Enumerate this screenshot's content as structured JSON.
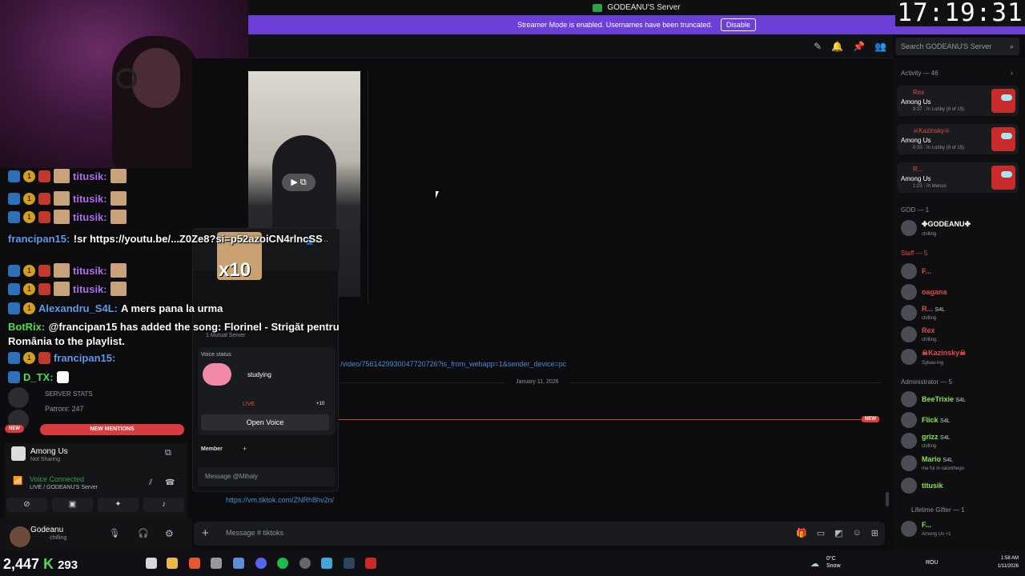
{
  "titlebar": {
    "title": "GODEANU'S Server"
  },
  "streamer": {
    "text": "Streamer Mode is enabled. Usernames have been truncated.",
    "disable": "Disable"
  },
  "clock": "17:19:31",
  "search": {
    "placeholder": "Search GODEANU'S Server"
  },
  "chat_overlay": [
    {
      "user": "titusik:",
      "color": "purple"
    },
    {
      "user": "titusik:",
      "color": "purple"
    },
    {
      "user": "titusik:",
      "color": "purple"
    },
    {
      "user": "francipan15:",
      "text": "!sr https://youtu.be/...Z0Ze8?si=p52azoiCN4rlncSS",
      "color": "blue"
    },
    {
      "user": "titusik:",
      "color": "purple"
    },
    {
      "user": "titusik:",
      "color": "purple"
    },
    {
      "user": "Alexandru_S4L:",
      "text": "A mers pana la urma",
      "color": "blue"
    },
    {
      "user": "BotRix:",
      "text": "@francipan15 has added the song: Florinel - Strigăt pentru România to the playlist.",
      "color": "green"
    },
    {
      "user": "francipan15:",
      "color": "blue"
    },
    {
      "user": "D_TX:",
      "color": "green"
    }
  ],
  "chat": {
    "link1": "/video/7561429930047720726?is_from_webapp=1&sender_device=pc",
    "date": "January 11, 2026",
    "new": "NEW",
    "last_link": "https://vm.tiktok.com/ZNRh8hv2n/",
    "composer_placeholder": "Message # tiktoks"
  },
  "left": {
    "server_stats": "SERVER STATS",
    "patroni": "Patroni: 247",
    "new": "NEW",
    "new_mentions": "NEW MENTIONS",
    "game": "Among Us",
    "game_sub": "Not Sharing",
    "voice_connected": "Voice Connected",
    "voice_sub": "LIVE / GODEANU'S Server",
    "username": "Godeanu",
    "user_status": "chilling"
  },
  "popout": {
    "x10": "x10",
    "mutual": "1 Mutual Server",
    "voice_status": "Voice status",
    "studying": "studying",
    "live": "LIVE",
    "count": "+10",
    "open_voice": "Open Voice",
    "member": "Member",
    "message_placeholder": "Message @Mihaly"
  },
  "right": {
    "activity": "Activity — 46",
    "cards": [
      {
        "name": "Rex",
        "game": "Among Us",
        "status": "9:37 · In Lobby (8 of 15)"
      },
      {
        "name": "☠Kazinsky☠",
        "game": "Among Us",
        "status": "0:33 · In Lobby (8 of 15)"
      },
      {
        "name": "R...",
        "game": "Among Us",
        "status": "1:23 · In Menus"
      }
    ],
    "god_header": "GOD — 1",
    "god": {
      "name": "✤GODEANU✤",
      "sub": "chilling"
    },
    "staff_header": "Staff — 5",
    "staff": [
      {
        "name": "F...",
        "sub": "",
        "color": "#e04b4b"
      },
      {
        "name": "oagana",
        "sub": "",
        "color": "#e04b4b"
      },
      {
        "name": "R...",
        "sub": "chilling",
        "color": "#e04b4b",
        "tag": "S4L"
      },
      {
        "name": "Rex",
        "sub": "chilling",
        "color": "#e04b4b"
      },
      {
        "name": "☠Kazinsky☠",
        "sub": "Sybau-ing",
        "color": "#e04b4b"
      }
    ],
    "admin_header": "Administrator — 5",
    "admins": [
      {
        "name": "BeeTrixie",
        "sub": "",
        "color": "#8be34b",
        "tag": "S4L"
      },
      {
        "name": "Flick",
        "sub": "",
        "color": "#8be34b",
        "tag": "S4L"
      },
      {
        "name": "grizz",
        "sub": "chilling",
        "color": "#8be34b",
        "tag": "S4L"
      },
      {
        "name": "Mario",
        "sub": "ma fut in raionthego",
        "color": "#8be34b",
        "tag": "S4L"
      },
      {
        "name": "titusik",
        "sub": "",
        "color": "#8be34b"
      }
    ],
    "gifter_header": "Lifetime Gifter — 1",
    "gifter": {
      "name": "F...",
      "sub": "Among Us +1"
    }
  },
  "taskbar": {
    "counter_a": "2,447",
    "counter_b": "293",
    "weather": "0°C",
    "weather_sub": "Snow",
    "lang": "ROU",
    "time": "1:58 AM",
    "date": "1/11/2026"
  }
}
